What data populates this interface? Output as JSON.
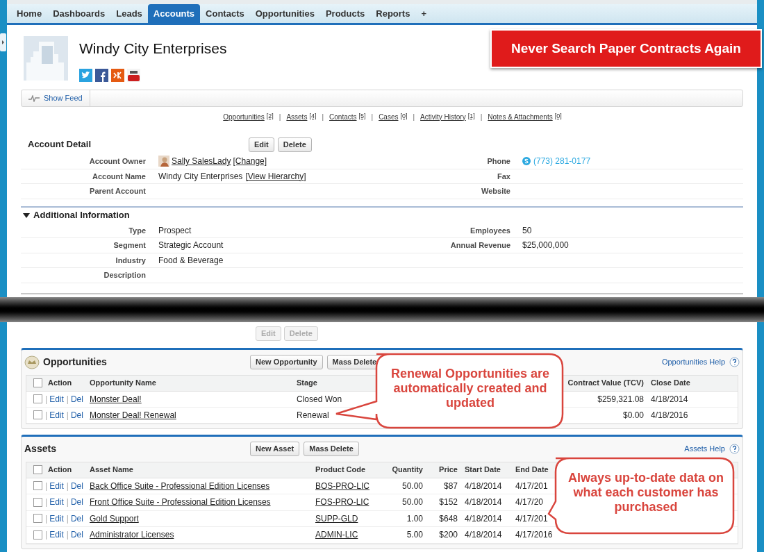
{
  "nav_tabs": [
    {
      "label": "Home",
      "selected": false
    },
    {
      "label": "Dashboards",
      "selected": false
    },
    {
      "label": "Leads",
      "selected": false
    },
    {
      "label": "Accounts",
      "selected": true
    },
    {
      "label": "Contacts",
      "selected": false
    },
    {
      "label": "Opportunities",
      "selected": false
    },
    {
      "label": "Products",
      "selected": false
    },
    {
      "label": "Reports",
      "selected": false
    },
    {
      "label": "+",
      "selected": false
    }
  ],
  "account": {
    "name": "Windy City Enterprises"
  },
  "banner": "Never Search Paper Contracts Again",
  "feed_button": "Show Feed",
  "related_links": [
    {
      "label": "Opportunities",
      "count": "[2]"
    },
    {
      "divider": "|",
      "label": "Assets",
      "count": "[4]"
    },
    {
      "divider": "|",
      "label": "Contacts",
      "count": "[5]"
    },
    {
      "divider": "|",
      "label": "Cases",
      "count": "[0]"
    },
    {
      "divider": "|",
      "label": "Activity History",
      "count": "[1]"
    },
    {
      "divider": "|",
      "label": "Notes & Attachments",
      "count": "[0]"
    }
  ],
  "account_detail": {
    "title": "Account Detail",
    "buttons": [
      "Edit",
      "Delete"
    ],
    "rows": [
      {
        "left": {
          "label": "Account Owner",
          "kind": "owner",
          "value": "Sally SalesLady",
          "link": "[Change]"
        },
        "right": {
          "label": "Phone",
          "kind": "phone",
          "value": "(773) 281-0177"
        }
      },
      {
        "left": {
          "label": "Account Name",
          "kind": "text",
          "value": "Windy City Enterprises",
          "link": "[View Hierarchy]"
        },
        "right": {
          "label": "Fax"
        }
      },
      {
        "left": {
          "label": "Parent Account"
        },
        "right": {
          "label": "Website"
        }
      }
    ]
  },
  "additional_info": {
    "title": "Additional Information",
    "expanded": true,
    "rows": [
      {
        "left": {
          "label": "Type",
          "kind": "text",
          "value": "Prospect"
        },
        "right": {
          "label": "Employees",
          "kind": "text",
          "value": "50"
        }
      },
      {
        "left": {
          "label": "Segment",
          "kind": "text",
          "value": "Strategic Account"
        },
        "right": {
          "label": "Annual Revenue",
          "kind": "text",
          "value": "$25,000,000"
        }
      },
      {
        "left": {
          "label": "Industry",
          "kind": "text",
          "value": "Food & Beverage"
        }
      },
      {
        "left": {
          "label": "Description"
        }
      }
    ]
  },
  "faded_buttons": [
    "Edit",
    "Delete"
  ],
  "opportunities": {
    "title": "Opportunities",
    "buttons": [
      "New Opportunity",
      "Mass Delete"
    ],
    "help": "Opportunities Help",
    "all_checked": false,
    "columns": [
      "Action",
      "Opportunity Name",
      "Stage",
      "Contract Value (TCV)",
      "Close Date"
    ],
    "rows": [
      {
        "checked": false,
        "actions": [
          {
            "divider": "|",
            "label": "Edit"
          },
          {
            "divider": "|",
            "label": "Del"
          }
        ],
        "name": "Monster Deal!",
        "stage": "Closed Won",
        "tcv": "$259,321.08",
        "close_date": "4/18/2014"
      },
      {
        "checked": false,
        "actions": [
          {
            "divider": "|",
            "label": "Edit"
          },
          {
            "divider": "|",
            "label": "Del"
          }
        ],
        "name": "Monster Deal! Renewal",
        "stage": "Renewal",
        "tcv": "$0.00",
        "close_date": "4/18/2016"
      }
    ]
  },
  "assets": {
    "title": "Assets",
    "buttons": [
      "New Asset",
      "Mass Delete"
    ],
    "help": "Assets Help",
    "all_checked": false,
    "columns": [
      "Action",
      "Asset Name",
      "Product Code",
      "Quantity",
      "Price",
      "Start Date",
      "End Date"
    ],
    "rows": [
      {
        "checked": false,
        "actions": [
          {
            "divider": "|",
            "label": "Edit"
          },
          {
            "divider": "|",
            "label": "Del"
          }
        ],
        "name": "Back Office Suite - Professional Edition Licenses",
        "code": "BOS-PRO-LIC",
        "quantity": "50.00",
        "price": "$87",
        "start": "4/18/2014",
        "end": "4/17/201"
      },
      {
        "checked": false,
        "actions": [
          {
            "divider": "|",
            "label": "Edit"
          },
          {
            "divider": "|",
            "label": "Del"
          }
        ],
        "name": "Front Office Suite - Professional Edition Licenses",
        "code": "FOS-PRO-LIC",
        "quantity": "50.00",
        "price": "$152",
        "start": "4/18/2014",
        "end": "4/17/20"
      },
      {
        "checked": false,
        "actions": [
          {
            "divider": "|",
            "label": "Edit"
          },
          {
            "divider": "|",
            "label": "Del"
          }
        ],
        "name": "Gold Support",
        "code": "SUPP-GLD",
        "quantity": "1.00",
        "price": "$648",
        "start": "4/18/2014",
        "end": "4/17/201"
      },
      {
        "checked": false,
        "actions": [
          {
            "divider": "|",
            "label": "Edit"
          },
          {
            "divider": "|",
            "label": "Del"
          }
        ],
        "name": "Administrator Licenses",
        "code": "ADMIN-LIC",
        "quantity": "5.00",
        "price": "$200",
        "start": "4/18/2014",
        "end": "4/17/2016"
      }
    ]
  },
  "callouts": [
    {
      "text": "Renewal Opportunities are automatically created and updated"
    },
    {
      "text": "Always up-to-date data on what each customer has purchased"
    }
  ]
}
